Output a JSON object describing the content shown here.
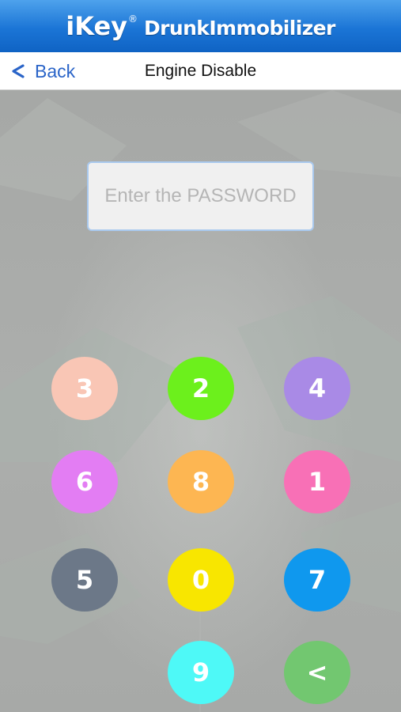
{
  "header": {
    "brand_main": "iKey",
    "brand_reg": "®",
    "brand_sub": "DrunkImmobilizer"
  },
  "nav": {
    "back_label": "Back",
    "title": "Engine Disable"
  },
  "password": {
    "placeholder": "Enter the PASSWORD",
    "value": ""
  },
  "keypad": {
    "keys": [
      {
        "label": "3",
        "color": "#f9c6b5"
      },
      {
        "label": "2",
        "color": "#6cf01c"
      },
      {
        "label": "4",
        "color": "#a98ae6"
      },
      {
        "label": "6",
        "color": "#e37df3"
      },
      {
        "label": "8",
        "color": "#fdb652"
      },
      {
        "label": "1",
        "color": "#f870b6"
      },
      {
        "label": "5",
        "color": "#6c7888"
      },
      {
        "label": "0",
        "color": "#f8e600"
      },
      {
        "label": "7",
        "color": "#0f98ee"
      },
      {
        "label": "9",
        "color": "#4ef9f7"
      },
      {
        "label": "<",
        "color": "#72c770"
      }
    ]
  },
  "colors": {
    "header_blue": "#1b75d6",
    "back_blue": "#2a64c8"
  }
}
